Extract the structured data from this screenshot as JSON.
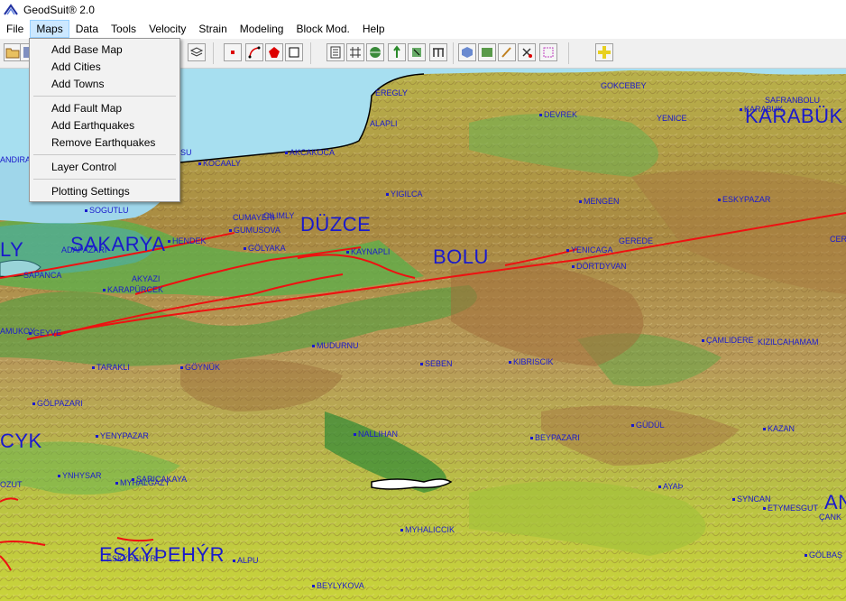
{
  "window": {
    "title": "GeodSuit® 2.0"
  },
  "menubar": {
    "items": [
      "File",
      "Maps",
      "Data",
      "Tools",
      "Velocity",
      "Strain",
      "Modeling",
      "Block Mod.",
      "Help"
    ],
    "active": "Maps"
  },
  "maps_menu": {
    "group1": [
      "Add Base Map",
      "Add Cities",
      "Add Towns"
    ],
    "group2": [
      "Add Fault Map",
      "Add Earthquakes",
      "Remove Earthquakes"
    ],
    "group3": [
      "Layer Control"
    ],
    "group4": [
      "Plotting Settings"
    ]
  },
  "map": {
    "provinces": [
      "DÜZCE",
      "SAKARYA",
      "BOLU",
      "KARABÜK",
      "ESKÝÞEHÝR",
      "LY",
      "CYK",
      "AN"
    ],
    "towns": [
      "EREGLY",
      "ALAPLI",
      "DEVREK",
      "GOKCEBEY",
      "SAFRANBOLU",
      "YENICE",
      "KARABUK",
      "AKCAKOCA",
      "KOCAALY",
      "ANDIRA",
      "SU",
      "YIGILCA",
      "MENGEN",
      "ESKYPAZAR",
      "SOGUTLU",
      "CUMAYERI",
      "GUMUSOVA",
      "CILIMLY",
      "HENDEK",
      "GÖLYAKA",
      "KAYNAPLI",
      "YENICAGA",
      "GEREDE",
      "CER",
      "ADAPAZARI",
      "SAPANCA",
      "AKYAZI",
      "KARAPÜRCEK",
      "DÖRTDYVAN",
      "AMUKOY",
      "GEYVE",
      "MUDURNU",
      "ÇAMLIDERE",
      "KIZILCAHAMAM",
      "TARAKLI",
      "GÖYNÜK",
      "SEBEN",
      "KIBRISCIK",
      "GÖLPAZARI",
      "GÜDÜL",
      "KAZAN",
      "YENYPAZAR",
      "NALLIHAN",
      "BEYPAZARI",
      "YNHYSAR",
      "SARICAKAYA",
      "MYHALGAZY",
      "OZUT",
      "AYAÞ",
      "SYNCAN",
      "ETYMESGUT",
      "ÇANK",
      "MYHALICCIK",
      "ALPU",
      "ESKÝÞEHÝR",
      "BEYLYKOVA",
      "GÖLBAŞ"
    ]
  },
  "colors": {
    "water": "#a7dff0",
    "label": "#1a1acc",
    "fault": "#ee1111",
    "menu_bg": "#f2f2f2",
    "menu_active": "#cce8ff"
  }
}
